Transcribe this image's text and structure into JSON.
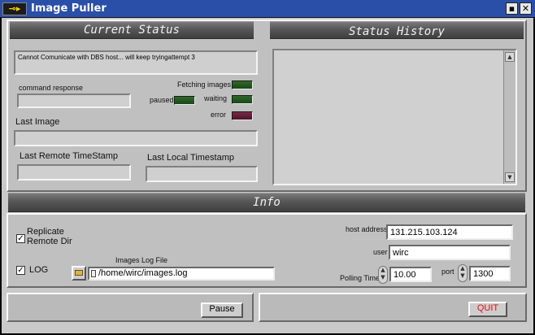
{
  "window": {
    "title": "Image Puller",
    "icon_text": "⊸▸",
    "minimize_glyph": "▪",
    "close_glyph": "✕"
  },
  "current_status": {
    "header": "Current Status",
    "message": "Cannot Comunicate with DBS host... will keep tryingattempt 3",
    "command_response_label": "command response",
    "command_response_value": "",
    "indicators": {
      "fetching_label": "Fetching images",
      "paused_label": "paused",
      "waiting_label": "waiting",
      "error_label": "error"
    },
    "last_image_label": "Last Image",
    "last_image_value": "",
    "last_remote_label": "Last Remote TimeStamp",
    "last_remote_value": "",
    "last_local_label": "Last Local Timestamp",
    "last_local_value": ""
  },
  "status_history": {
    "header": "Status History",
    "scroll_up": "▲",
    "scroll_down": "▼"
  },
  "info": {
    "header": "Info",
    "replicate_label_1": "Replicate",
    "replicate_label_2": "Remote Dir",
    "replicate_checked": "✓",
    "log_label": "LOG",
    "log_checked": "✓",
    "images_log_file_label": "Images Log File",
    "images_log_file_value": "/home/wirc/images.log",
    "host_address_label": "host address",
    "host_address_value": "131.215.103.124",
    "user_label": "user",
    "user_value": "wirc",
    "polling_time_label": "Polling Time",
    "polling_time_value": "10.00",
    "port_label": "port",
    "port_value": "1300",
    "spinner_glyph": "▲\n▼"
  },
  "controls": {
    "pause_label": "Pause",
    "quit_label": "QUIT",
    "quit_color": "#e01010"
  }
}
